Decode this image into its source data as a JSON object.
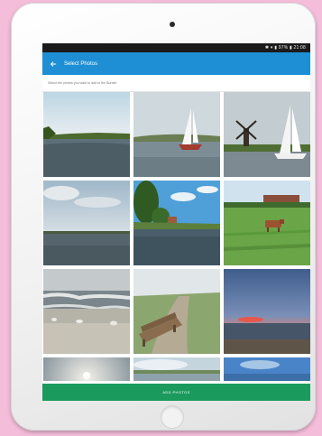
{
  "status_bar": {
    "time": "21:08",
    "battery": "97%"
  },
  "app_bar": {
    "title": "Select Photos",
    "back_icon": "arrow-left-icon"
  },
  "subheader": {
    "text": "Select the photos you want to add to the Bundle"
  },
  "photos": [
    {
      "scene": "canal-sunny"
    },
    {
      "scene": "sailboat-pink-sail"
    },
    {
      "scene": "windmill-sailboat"
    },
    {
      "scene": "cloudy-lake"
    },
    {
      "scene": "canal-trees-blue-sky"
    },
    {
      "scene": "meadow-cow"
    },
    {
      "scene": "beach-waves-seagulls"
    },
    {
      "scene": "wooden-bench-dune"
    },
    {
      "scene": "sunset-sea"
    },
    {
      "scene": "sun-haze"
    },
    {
      "scene": "coast-clouds"
    },
    {
      "scene": "blue-sky-sea"
    }
  ],
  "action_button": {
    "label": "ADD PHOTOS"
  },
  "colors": {
    "app_bar": "#1e8fd4",
    "action_button": "#1a9a5d",
    "background": "#f4bdd9"
  }
}
